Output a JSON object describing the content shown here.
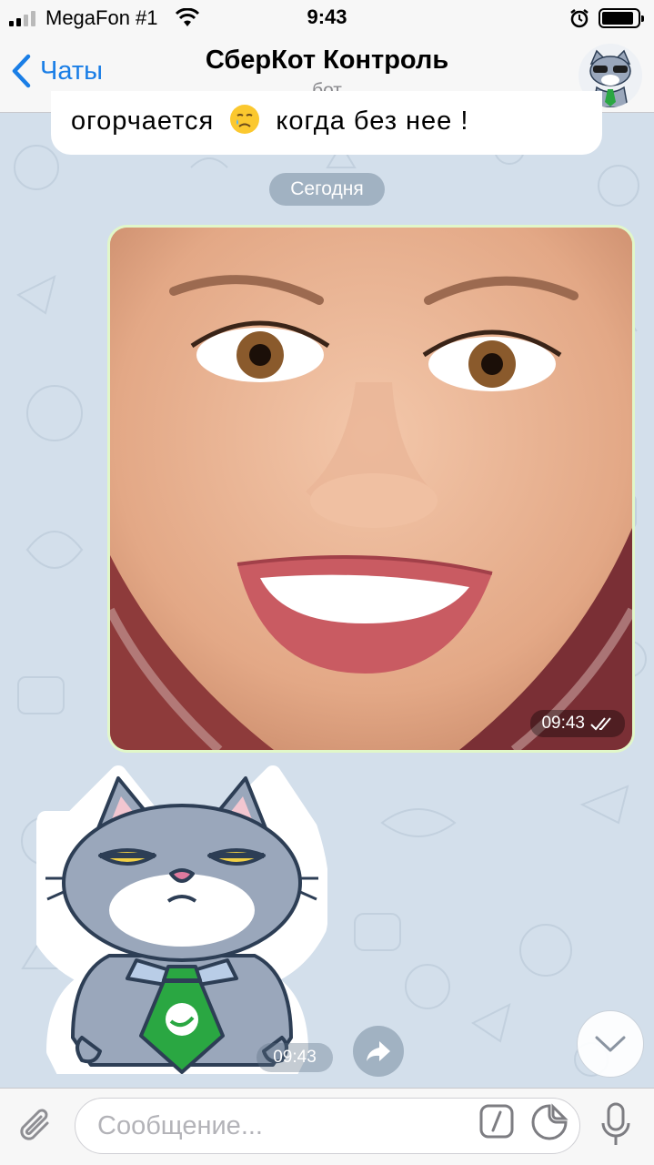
{
  "status_bar": {
    "carrier": "MegaFon #1",
    "time": "9:43"
  },
  "nav": {
    "back_label": "Чаты",
    "title": "СберКот Контроль",
    "subtitle": "бот"
  },
  "messages": {
    "previous_text_part1": "огорчается",
    "previous_text_part2": "когда без нее !",
    "date_separator": "Сегодня",
    "photo_time": "09:43",
    "sticker_time": "09:43"
  },
  "input": {
    "placeholder": "Сообщение..."
  },
  "colors": {
    "accent": "#1a7ee6",
    "outgoing_border": "#e1f7c9",
    "wallpaper": "#d3dfeb"
  },
  "icons": {
    "back": "chevron-left-icon",
    "attach": "paperclip-icon",
    "command": "slash-command-icon",
    "sticker": "sticker-icon",
    "mic": "microphone-icon",
    "share": "share-arrow-icon",
    "scroll": "chevron-down-icon",
    "read_status": "double-check-icon"
  }
}
